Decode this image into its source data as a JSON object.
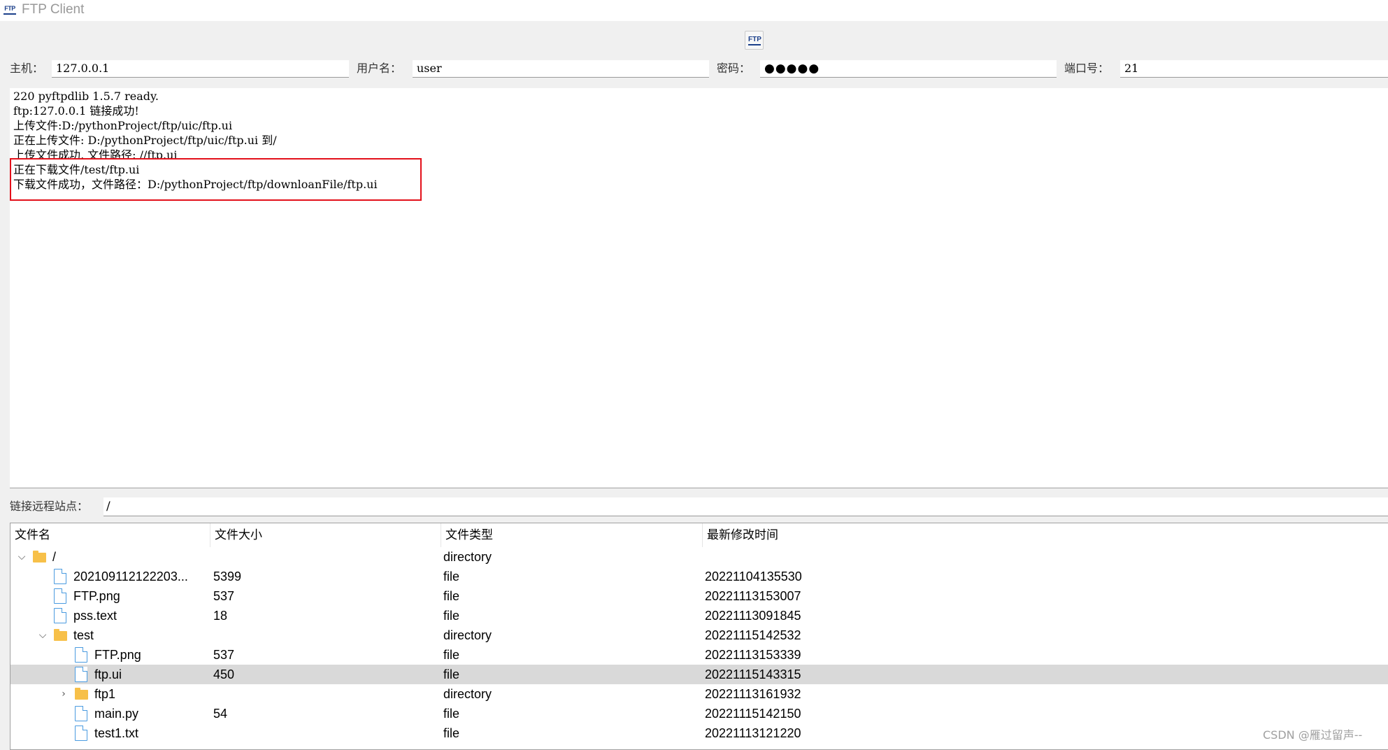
{
  "window": {
    "title": "FTP Client",
    "app_icon_text": "FTP"
  },
  "toolbar": {
    "ftp_button_text": "FTP"
  },
  "connection": {
    "host_label": "主机：",
    "host_value": "127.0.0.1",
    "user_label": "用户名：",
    "user_value": "user",
    "password_label": "密码：",
    "password_value": "●●●●●",
    "port_label": "端口号：",
    "port_value": "21"
  },
  "log": {
    "lines": [
      "220 pyftpdlib 1.5.7 ready.",
      "ftp:127.0.0.1 链接成功!",
      "上传文件:D:/pythonProject/ftp/uic/ftp.ui",
      "正在上传文件: D:/pythonProject/ftp/uic/ftp.ui 到/",
      "上传文件成功, 文件路径: //ftp.ui",
      "正在下载文件/test/ftp.ui",
      "下载文件成功，文件路径：D:/pythonProject/ftp/downloanFile/ftp.ui"
    ],
    "highlight_color": "#e3101a"
  },
  "remote": {
    "label": "链接远程站点：",
    "path": "/"
  },
  "file_tree": {
    "columns": [
      "文件名",
      "文件大小",
      "文件类型",
      "最新修改时间"
    ],
    "rows": [
      {
        "name": "/",
        "size": "",
        "type": "directory",
        "modified": "",
        "kind": "folder",
        "toggle": "expanded"
      },
      {
        "name": "202109112122203...",
        "size": "5399",
        "type": "file",
        "modified": "20221104135530",
        "kind": "file"
      },
      {
        "name": "FTP.png",
        "size": "537",
        "type": "file",
        "modified": "20221113153007",
        "kind": "file"
      },
      {
        "name": "pss.text",
        "size": "18",
        "type": "file",
        "modified": "20221113091845",
        "kind": "file"
      },
      {
        "name": "test",
        "size": "",
        "type": "directory",
        "modified": "20221115142532",
        "kind": "folder",
        "toggle": "expanded"
      },
      {
        "name": "FTP.png",
        "size": "537",
        "type": "file",
        "modified": "20221113153339",
        "kind": "file"
      },
      {
        "name": "ftp.ui",
        "size": "450",
        "type": "file",
        "modified": "20221115143315",
        "kind": "file",
        "selected": true
      },
      {
        "name": "ftp1",
        "size": "",
        "type": "directory",
        "modified": "20221113161932",
        "kind": "folder",
        "toggle": "collapsed"
      },
      {
        "name": "main.py",
        "size": "54",
        "type": "file",
        "modified": "20221115142150",
        "kind": "file"
      },
      {
        "name": "test1.txt",
        "size": "",
        "type": "file",
        "modified": "20221113121220",
        "kind": "file"
      }
    ],
    "selected_color": "#d9d9d9",
    "folder_color": "#f7c049",
    "file_icon_color": "#4a9be0"
  },
  "watermark": "CSDN @雁过留声--"
}
